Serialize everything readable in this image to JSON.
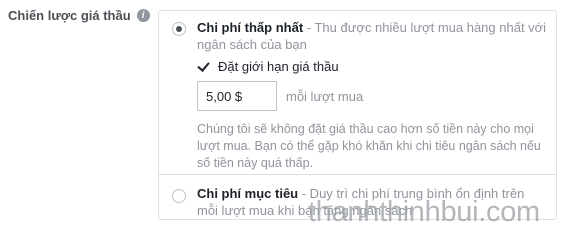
{
  "field": {
    "label": "Chiến lược giá thầu",
    "info_icon": "info-icon"
  },
  "options": [
    {
      "title": "Chi phí thấp nhất",
      "description": " - Thu được nhiều lượt mua hàng nhất với ngân sách của bạn",
      "selected": true
    },
    {
      "title": "Chi phí mục tiêu",
      "description": " - Duy trì chi phí trung bình ổn định trên mỗi lượt mua khi bạn tăng ngân sách",
      "selected": false
    }
  ],
  "bid_cap": {
    "checkbox_label": "Đặt giới hạn giá thầu",
    "checked": true,
    "value": "5,00 $",
    "suffix": "mỗi lượt mua",
    "notice": "Chúng tôi sẽ không đặt giá thầu cao hơn số tiền này cho mọi lượt mua. Bạn có thể gặp khó khăn khi chi tiêu ngân sách nếu số tiền này quá thấp."
  },
  "watermark": "thanhthinhbui.com"
}
